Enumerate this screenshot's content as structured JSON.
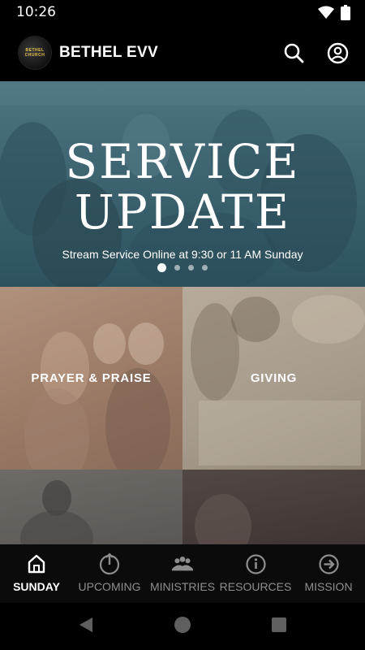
{
  "status_bar": {
    "time": "10:26",
    "icons": [
      "wifi-icon",
      "battery-icon"
    ]
  },
  "app_bar": {
    "logo_text": "BETHEL CHURCH",
    "title": "BETHEL EVV",
    "actions": [
      "search-icon",
      "account-icon"
    ]
  },
  "hero": {
    "title_line1": "SERVICE",
    "title_line2": "UPDATE",
    "subtitle": "Stream Service Online at 9:30 or 11 AM Sunday",
    "slide_count": 4,
    "active_slide": 1
  },
  "tiles": [
    {
      "label": "PRAYER & PRAISE"
    },
    {
      "label": "GIVING"
    },
    {
      "label": ""
    },
    {
      "label": ""
    }
  ],
  "bottom_nav": {
    "items": [
      {
        "label": "SUNDAY",
        "icon": "home-icon",
        "active": true
      },
      {
        "label": "UPCOMING",
        "icon": "upcoming-icon",
        "active": false
      },
      {
        "label": "MINISTRIES",
        "icon": "people-icon",
        "active": false
      },
      {
        "label": "RESOURCES",
        "icon": "info-icon",
        "active": false
      },
      {
        "label": "MISSION",
        "icon": "arrow-circle-icon",
        "active": false
      }
    ]
  },
  "system_nav": [
    "back-icon",
    "home-circle-icon",
    "recents-icon"
  ],
  "colors": {
    "background": "#000000",
    "hero": "#3d6470",
    "active_nav": "#ffffff",
    "inactive_nav": "#8e8e8e"
  }
}
